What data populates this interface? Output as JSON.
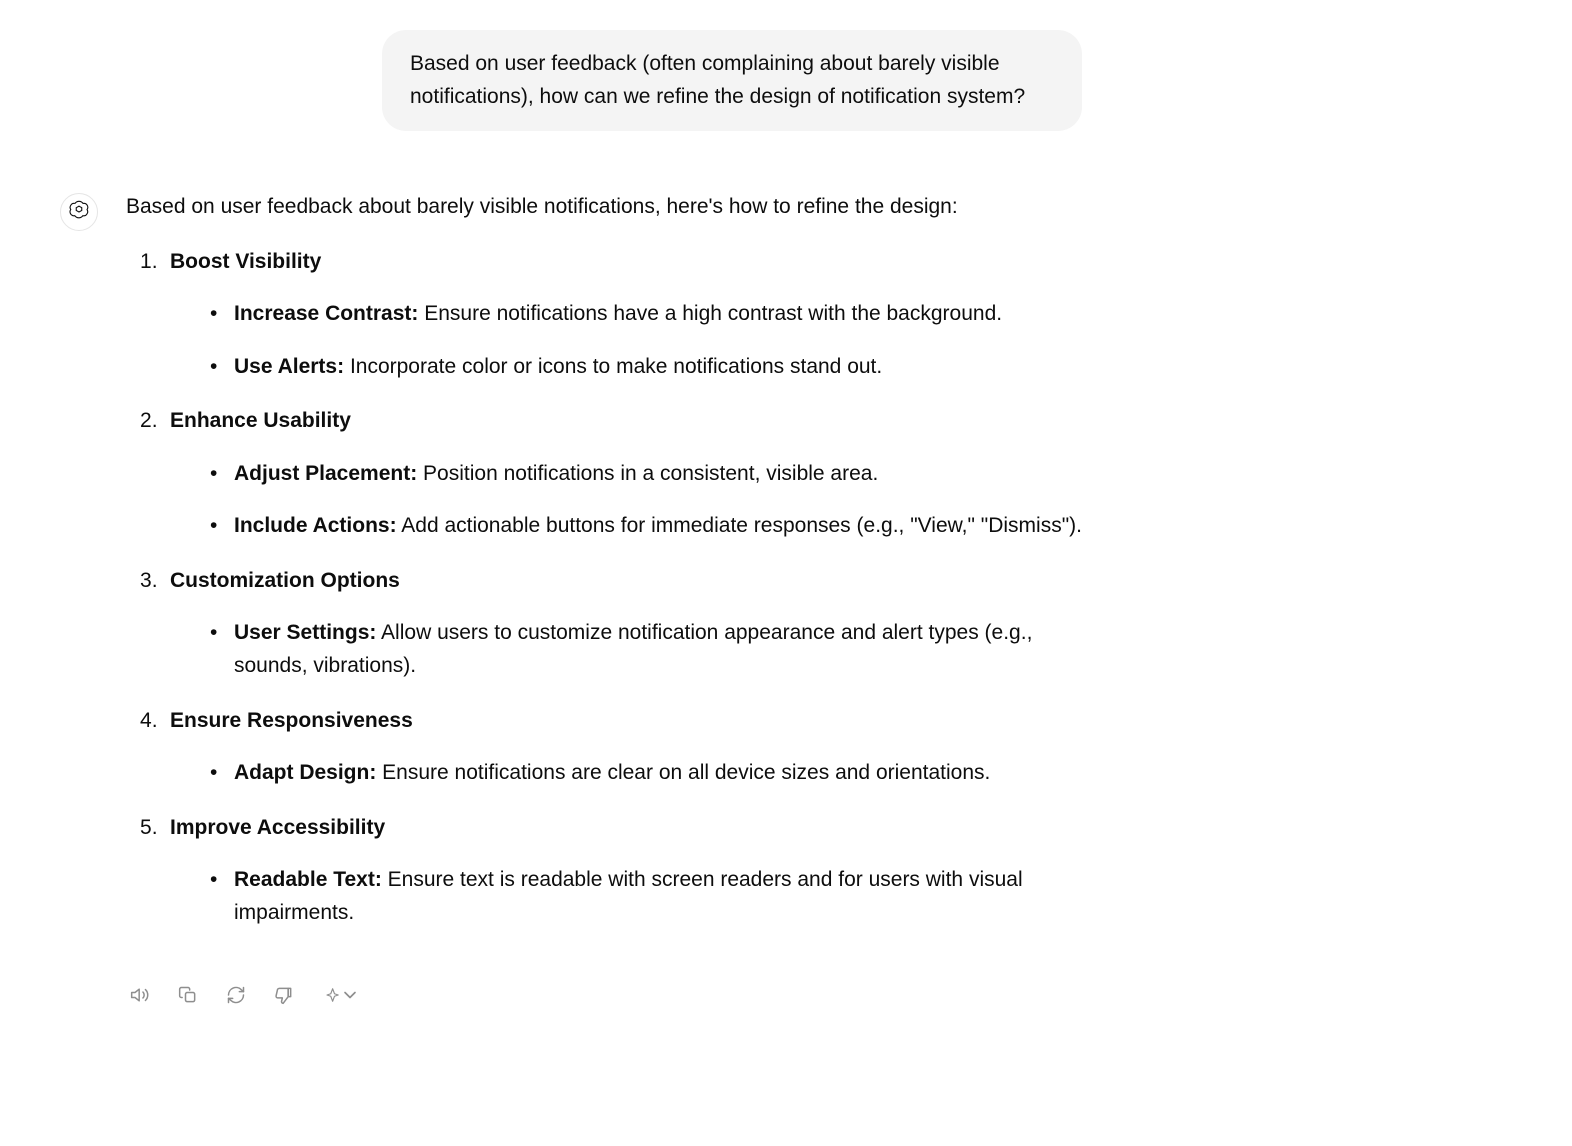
{
  "user": {
    "message": "Based on user feedback (often complaining about barely visible notifications), how can we refine the design of notification system?"
  },
  "assistant": {
    "intro": "Based on user feedback about barely visible notifications, here's how to refine the design:",
    "sections": [
      {
        "title": "Boost Visibility",
        "bullets": [
          {
            "label": "Increase Contrast:",
            "text": " Ensure notifications have a high contrast with the background."
          },
          {
            "label": "Use Alerts:",
            "text": " Incorporate color or icons to make notifications stand out."
          }
        ]
      },
      {
        "title": "Enhance Usability",
        "bullets": [
          {
            "label": "Adjust Placement:",
            "text": " Position notifications in a consistent, visible area."
          },
          {
            "label": "Include Actions:",
            "text": " Add actionable buttons for immediate responses (e.g., \"View,\" \"Dismiss\")."
          }
        ]
      },
      {
        "title": "Customization Options",
        "bullets": [
          {
            "label": "User Settings:",
            "text": " Allow users to customize notification appearance and alert types (e.g., sounds, vibrations)."
          }
        ]
      },
      {
        "title": "Ensure Responsiveness",
        "bullets": [
          {
            "label": "Adapt Design:",
            "text": " Ensure notifications are clear on all device sizes and orientations."
          }
        ]
      },
      {
        "title": "Improve Accessibility",
        "bullets": [
          {
            "label": "Readable Text:",
            "text": " Ensure text is readable with screen readers and for users with visual impairments."
          }
        ]
      }
    ]
  }
}
